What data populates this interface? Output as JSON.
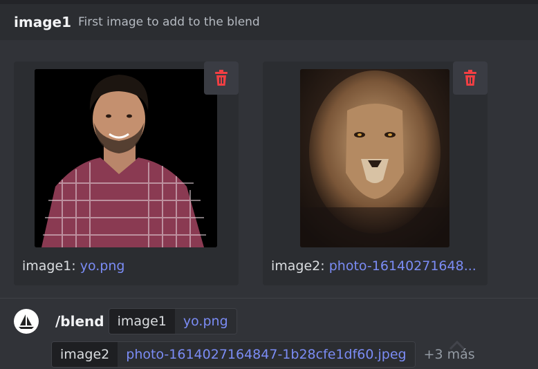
{
  "hint": {
    "name": "image1",
    "description": "First image to add to the blend"
  },
  "attachments": [
    {
      "option": "image1:",
      "filename": "yo.png",
      "icon": "trash-icon",
      "preview": "man-plaid-shirt-photo"
    },
    {
      "option": "image2:",
      "filename": "photo-16140271648...",
      "icon": "trash-icon",
      "preview": "lion-portrait-photo"
    }
  ],
  "command": {
    "name": "/blend",
    "options": [
      {
        "key": "image1",
        "value": "yo.png"
      },
      {
        "key": "image2",
        "value": "photo-1614027164847-1b28cfe1df60.jpeg"
      }
    ],
    "more": "+3 más"
  },
  "colors": {
    "background": "#313338",
    "link": "#7b8cf5",
    "delete": "#f23f43"
  }
}
